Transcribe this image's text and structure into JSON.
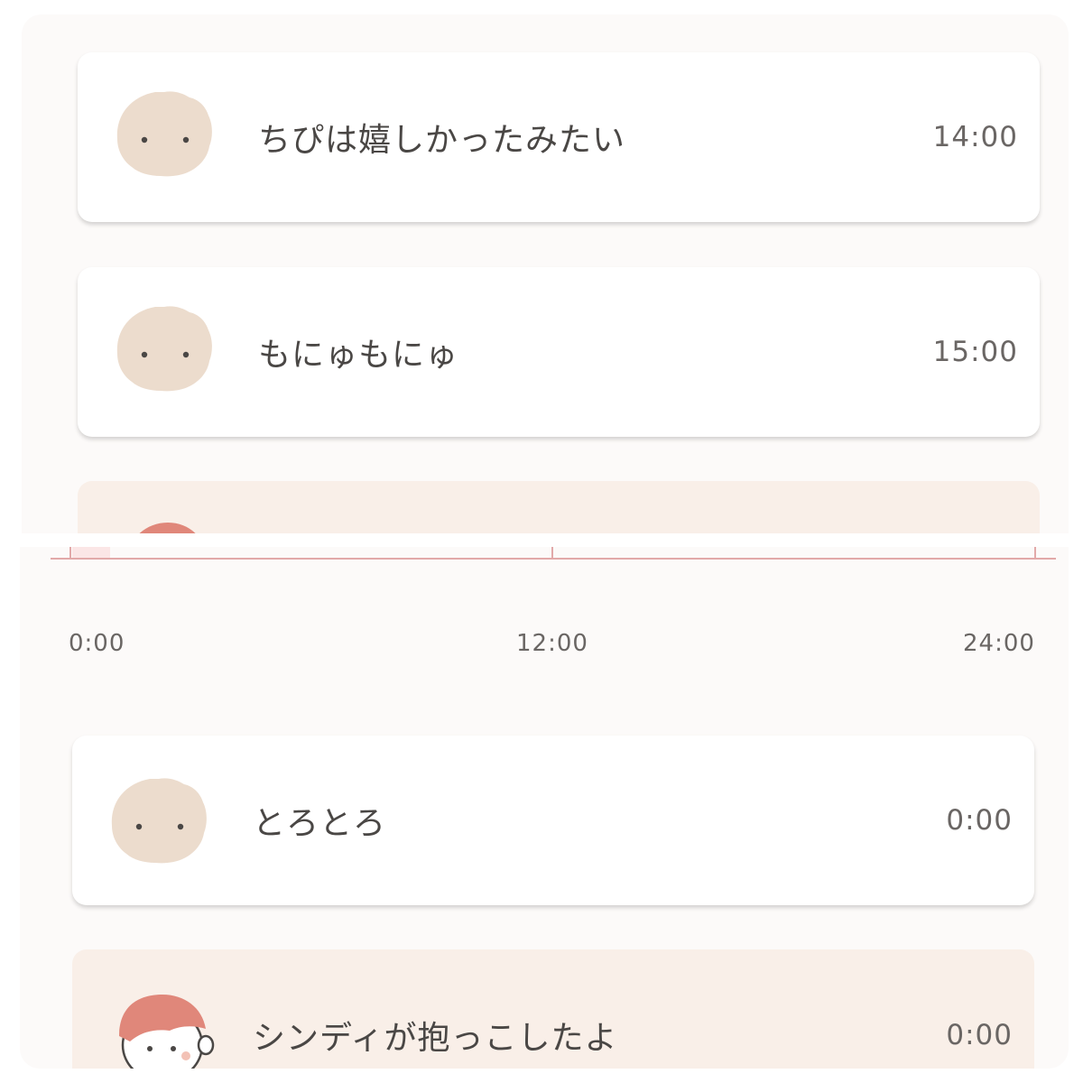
{
  "top_list": {
    "items": [
      {
        "avatar": "fluffy-face-icon",
        "label": "ちぴは嬉しかったみたい",
        "time": "14:00"
      },
      {
        "avatar": "fluffy-face-icon",
        "label": "もにゅもにゅ",
        "time": "15:00"
      },
      {
        "avatar": "person-face-icon",
        "label": "",
        "time": ""
      }
    ]
  },
  "timeline": {
    "ticks": [
      "0:00",
      "12:00",
      "24:00"
    ],
    "line_color": "#e2a9a9"
  },
  "bottom_list": {
    "items": [
      {
        "avatar": "fluffy-face-icon",
        "label": "とろとろ",
        "time": "0:00"
      },
      {
        "avatar": "person-face-icon",
        "label": "シンディが抱っこしたよ",
        "time": "0:00"
      }
    ]
  },
  "colors": {
    "card": "#ffffff",
    "card_alt": "#f9efe8",
    "fluffy_avatar": "#ecdccd",
    "person_hair": "#e0877a",
    "panel_bg": "#fcfaf9"
  }
}
